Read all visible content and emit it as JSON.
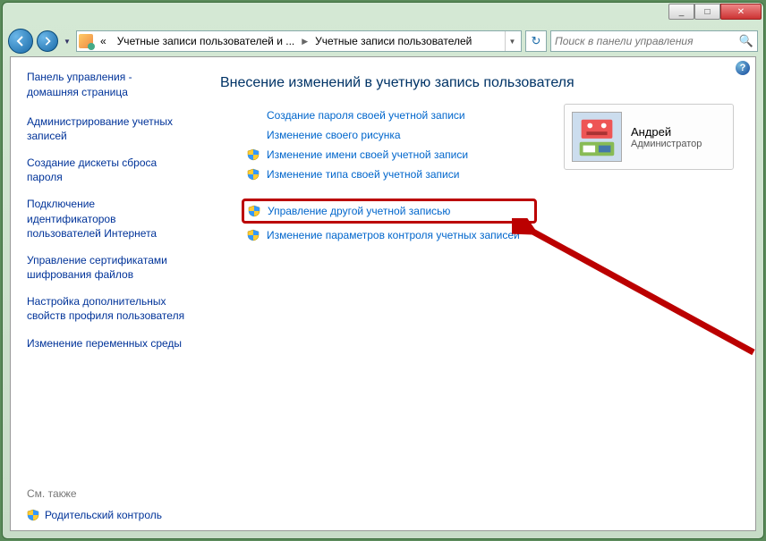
{
  "titlebar": {
    "minimize": "_",
    "maximize": "□",
    "close": "✕"
  },
  "address": {
    "prefix": "«",
    "seg1": "Учетные записи пользователей и ...",
    "seg2": "Учетные записи пользователей"
  },
  "search": {
    "placeholder": "Поиск в панели управления"
  },
  "sidebar": {
    "home": "Панель управления - домашняя страница",
    "links": [
      "Администрирование учетных записей",
      "Создание дискеты сброса пароля",
      "Подключение идентификаторов пользователей Интернета",
      "Управление сертификатами шифрования файлов",
      "Настройка дополнительных свойств профиля пользователя",
      "Изменение переменных среды"
    ],
    "also_label": "См. также",
    "parental": "Родительский контроль"
  },
  "main": {
    "heading": "Внесение изменений в учетную запись пользователя",
    "tasks": [
      {
        "label": "Создание пароля своей учетной записи",
        "shield": false
      },
      {
        "label": "Изменение своего рисунка",
        "shield": false
      },
      {
        "label": "Изменение имени своей учетной записи",
        "shield": true
      },
      {
        "label": "Изменение типа своей учетной записи",
        "shield": true
      }
    ],
    "highlighted_task": {
      "label": "Управление другой учетной записью",
      "shield": true
    },
    "uac_task": {
      "label": "Изменение параметров контроля учетных записей",
      "shield": true
    }
  },
  "user": {
    "name": "Андрей",
    "role": "Администратор"
  }
}
